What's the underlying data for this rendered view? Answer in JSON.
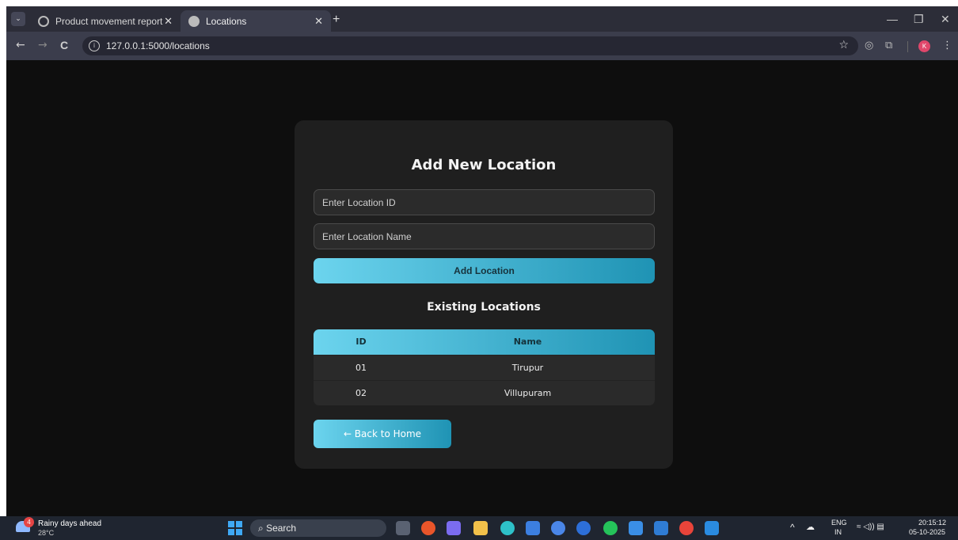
{
  "browser": {
    "tabs": [
      {
        "title": "Product movement report",
        "close": "✕"
      },
      {
        "title": "Locations",
        "close": "✕"
      }
    ],
    "new_tab": "+",
    "window_controls": {
      "minimize": "—",
      "restore": "❐",
      "close": "✕"
    },
    "nav": {
      "back": "←",
      "forward": "→",
      "reload": "C"
    },
    "url": "127.0.0.1:5000/locations",
    "profile_initial": "K",
    "bookmark_icon": "☆"
  },
  "form": {
    "title": "Add New Location",
    "id_placeholder": "Enter Location ID",
    "name_placeholder": "Enter Location Name",
    "submit_label": "Add Location"
  },
  "locations": {
    "title": "Existing Locations",
    "columns": {
      "id": "ID",
      "name": "Name"
    },
    "rows": [
      {
        "id": "01",
        "name": "Tirupur"
      },
      {
        "id": "02",
        "name": "Villupuram"
      }
    ]
  },
  "back_button": "← Back to Home",
  "taskbar": {
    "weather_title": "Rainy days ahead",
    "weather_temp": "28°C",
    "weather_badge": "4",
    "search_label": "Search",
    "lang_top": "ENG",
    "lang_bottom": "IN",
    "time": "20:15:12",
    "date": "05-10-2025",
    "tray_chevron": "^",
    "tray_icons": "≈ ◁)) ▤"
  }
}
